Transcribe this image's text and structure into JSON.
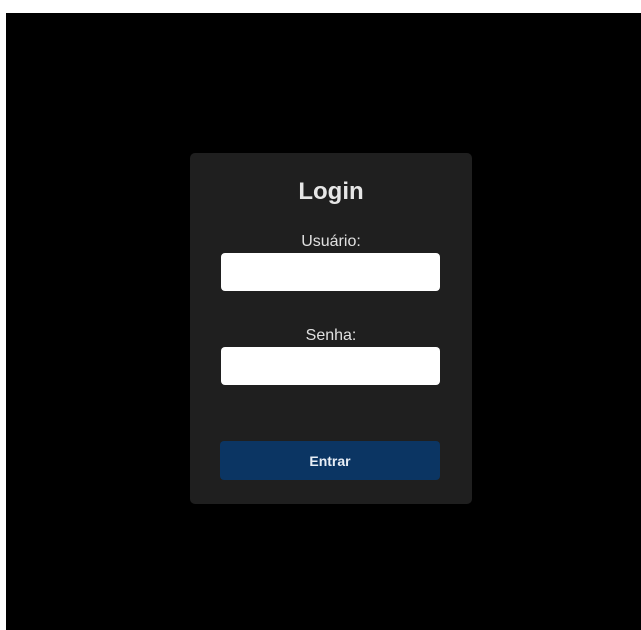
{
  "login": {
    "title": "Login",
    "username_label": "Usuário:",
    "username_value": "",
    "password_label": "Senha:",
    "password_value": "",
    "submit_label": "Entrar"
  },
  "colors": {
    "page_background": "#000000",
    "card_background": "#1f1f1f",
    "button_background": "#0b3563",
    "input_background": "#ffffff",
    "text": "#e6e6e6"
  }
}
